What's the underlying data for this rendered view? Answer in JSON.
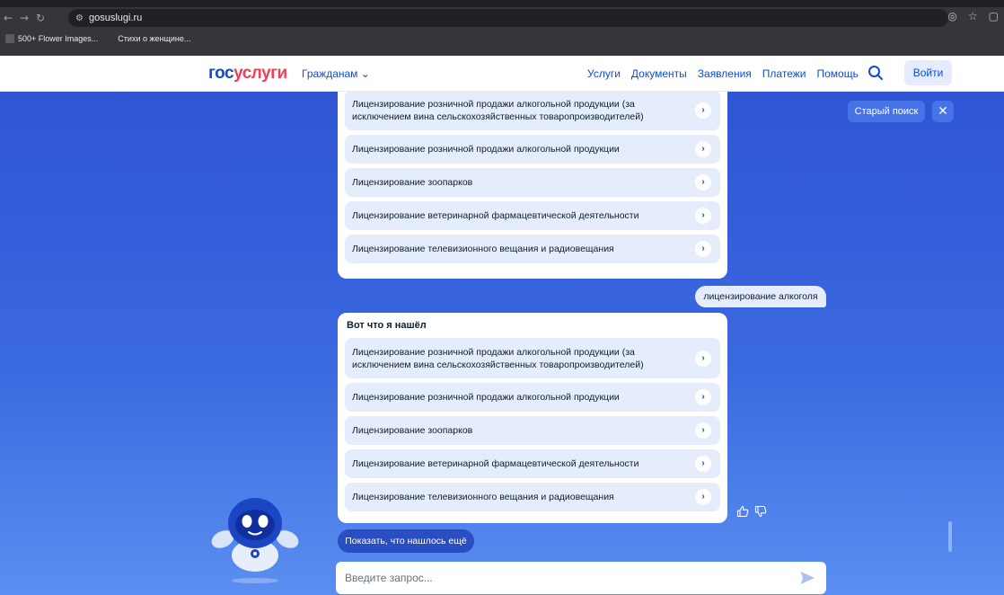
{
  "browser": {
    "url": "gosuslugi.ru",
    "bookmarks": [
      "500+ Flower Images...",
      "Стихи о женщине..."
    ]
  },
  "header": {
    "logo_part1": "гос",
    "logo_part2": "услуги",
    "citizens": "Гражданам ⌄",
    "nav": [
      "Услуги",
      "Документы",
      "Заявления",
      "Платежи",
      "Помощь"
    ],
    "login": "Войти"
  },
  "top_right": {
    "old_search": "Старый поиск",
    "close": "✕"
  },
  "chat": {
    "panel1_items": [
      "Лицензирование розничной продажи алкогольной продукции (за исключением вина сельскохозяйственных товаропроизводителей)",
      "Лицензирование розничной продажи алкогольной продукции",
      "Лицензирование зоопарков",
      "Лицензирование ветеринарной фармацевтической деятельности",
      "Лицензирование телевизионного вещания и радиовещания"
    ],
    "user_message": "лицензирование алкоголя",
    "panel2_title": "Вот что я нашёл",
    "panel2_items": [
      "Лицензирование розничной продажи алкогольной продукции (за исключением вина сельскохозяйственных товаропроизводителей)",
      "Лицензирование розничной продажи алкогольной продукции",
      "Лицензирование зоопарков",
      "Лицензирование ветеринарной фармацевтической деятельности",
      "Лицензирование телевизионного вещания и радиовещания"
    ],
    "show_more": "Показать, что нашлось ещё",
    "input_placeholder": "Введите запрос..."
  },
  "colors": {
    "brand_blue": "#0d4cd3",
    "brand_red": "#ee3f58",
    "bg_blue": "#2f55d4"
  }
}
